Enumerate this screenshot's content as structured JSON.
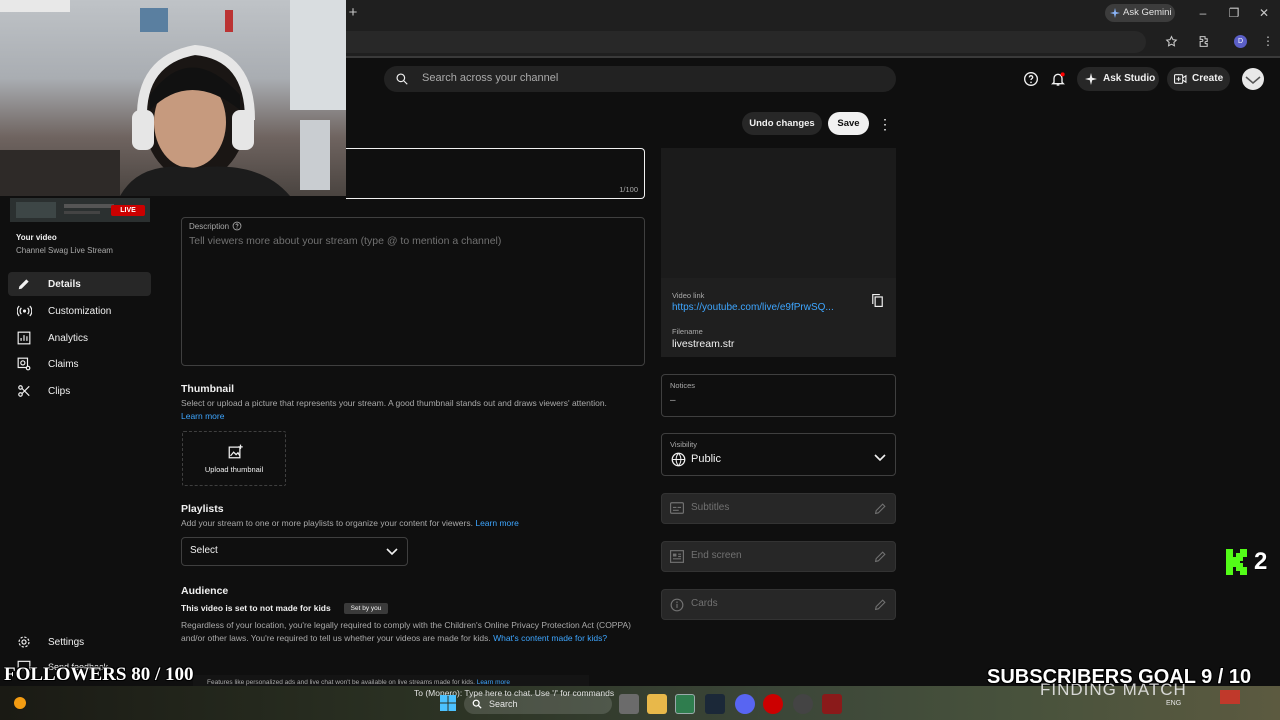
{
  "browser": {
    "gemini_label": "Ask Gemini",
    "profile_initial": "D"
  },
  "header": {
    "search_placeholder": "Search across your channel",
    "ask_studio_label": "Ask Studio",
    "create_label": "Create"
  },
  "stream_overlay": {
    "live_badge": "LIVE",
    "followers_text": "FOLLOWERS 80 / 100",
    "subscribers_text": "SUBSCRIBERS GOAL 9 / 10",
    "finding_match_text": "FINDING MATCH",
    "score_badge": "2",
    "chat_hint": "To (Monero): Type here to chat. Use '/' for commands"
  },
  "sidebar": {
    "your_video_label": "Your video",
    "video_title": "Channel Swag Live Stream",
    "items": [
      {
        "label": "Details",
        "icon": "pencil-icon",
        "active": true
      },
      {
        "label": "Customization",
        "icon": "broadcast-icon",
        "active": false
      },
      {
        "label": "Analytics",
        "icon": "bar-chart-icon",
        "active": false
      },
      {
        "label": "Claims",
        "icon": "copyright-claims-icon",
        "active": false
      },
      {
        "label": "Clips",
        "icon": "scissors-icon",
        "active": false
      }
    ],
    "settings_label": "Settings",
    "feedback_label": "Send feedback"
  },
  "toolbar": {
    "undo_label": "Undo changes",
    "save_label": "Save"
  },
  "form": {
    "title_counter": "1/100",
    "description_label": "Description",
    "description_placeholder": "Tell viewers more about your stream (type @ to mention a channel)",
    "thumbnail_title": "Thumbnail",
    "thumbnail_text": "Select or upload a picture that represents your stream. A good thumbnail stands out and draws viewers' attention.",
    "learn_more": "Learn more",
    "upload_thumbnail": "Upload thumbnail",
    "playlists_title": "Playlists",
    "playlists_text": "Add your stream to one or more playlists to organize your content for viewers.",
    "playlist_select": "Select",
    "audience_title": "Audience",
    "audience_status": "This video is set to not made for kids",
    "set_by_you": "Set by you",
    "audience_text": "Regardless of your location, you're legally required to comply with the Children's Online Privacy Protection Act (COPPA) and/or other laws. You're required to tell us whether your videos are made for kids.",
    "whats_content": "What's content made for kids?",
    "footer_note": "Features like personalized ads and live chat won't be available on live streams made for kids.",
    "footer_learn_more": "Learn more"
  },
  "right_panel": {
    "video_link_label": "Video link",
    "video_link": "https://youtube.com/live/e9fPrwSQ...",
    "filename_label": "Filename",
    "filename": "livestream.str",
    "notices_label": "Notices",
    "notices_value": "–",
    "visibility_label": "Visibility",
    "visibility_value": "Public",
    "subtitles_label": "Subtitles",
    "end_screen_label": "End screen",
    "cards_label": "Cards"
  },
  "taskbar": {
    "search_label": "Search",
    "lang": "ENG"
  }
}
